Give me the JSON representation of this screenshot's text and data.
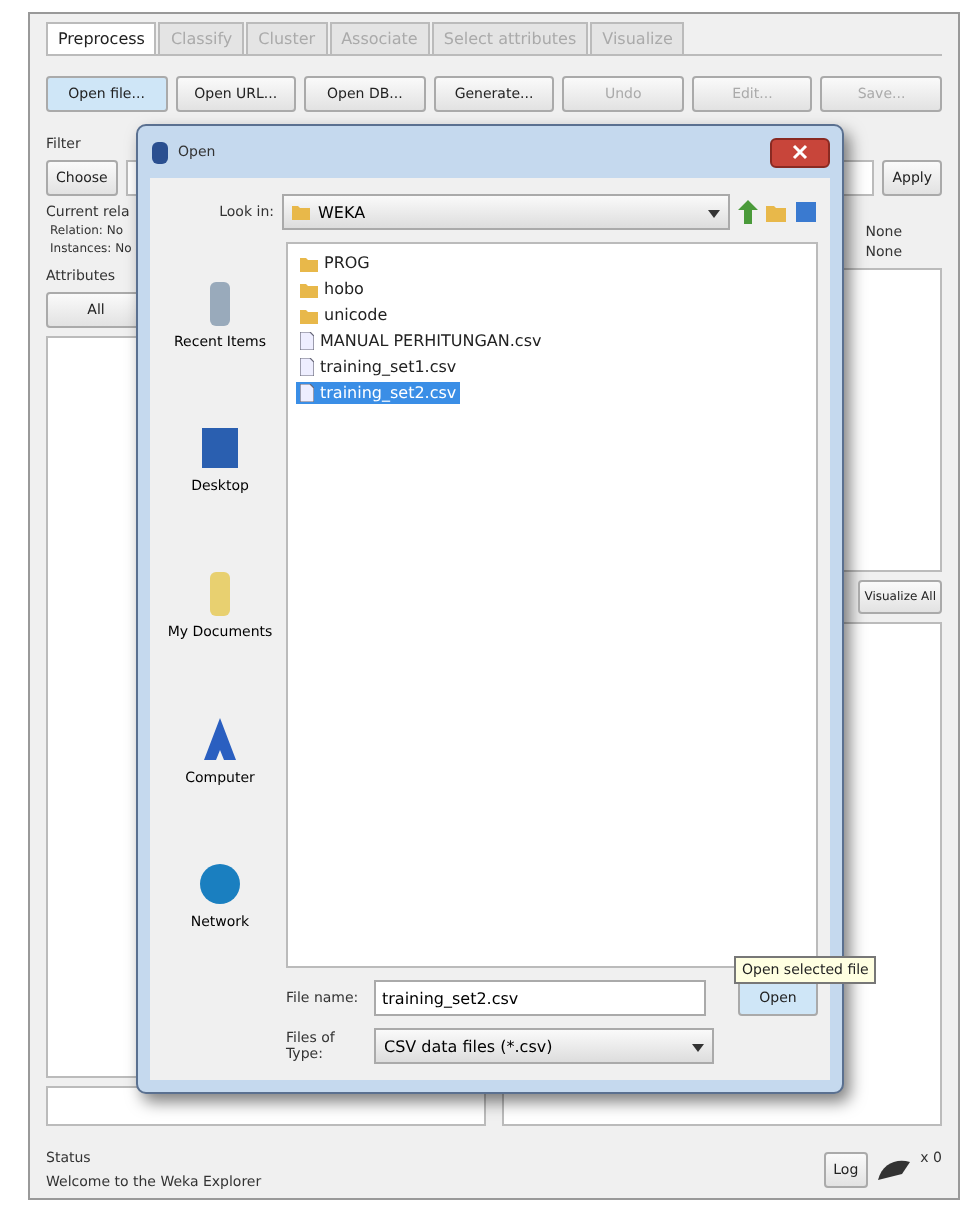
{
  "explorer": {
    "tabs": [
      {
        "label": "Preprocess",
        "selected": true
      },
      {
        "label": "Classify",
        "selected": false
      },
      {
        "label": "Cluster",
        "selected": false
      },
      {
        "label": "Associate",
        "selected": false
      },
      {
        "label": "Select attributes",
        "selected": false
      },
      {
        "label": "Visualize",
        "selected": false
      }
    ],
    "toolbar": [
      {
        "label": "Open file...",
        "disabled": false,
        "selected": true
      },
      {
        "label": "Open URL...",
        "disabled": false,
        "selected": false
      },
      {
        "label": "Open DB...",
        "disabled": false,
        "selected": false
      },
      {
        "label": "Generate...",
        "disabled": false,
        "selected": false
      },
      {
        "label": "Undo",
        "disabled": true,
        "selected": false
      },
      {
        "label": "Edit...",
        "disabled": true,
        "selected": false
      },
      {
        "label": "Save...",
        "disabled": true,
        "selected": false
      }
    ],
    "filter_label": "Filter",
    "choose_button": "Choose",
    "apply_button": "Apply",
    "current_relation": "Current rela",
    "relation": "Relation: No",
    "instances": "Instances: No",
    "right_values": [
      "None",
      "None"
    ],
    "attributes_label": "Attributes",
    "all_button": "All",
    "visualize_all_button": "Visualize All",
    "status_label": "Status",
    "status_message": "Welcome to the Weka Explorer",
    "log_button": "Log",
    "task_count": "x 0"
  },
  "dialog": {
    "title": "Open",
    "look_in_label": "Look in:",
    "look_in_value": "WEKA",
    "places": [
      {
        "label": "Recent Items"
      },
      {
        "label": "Desktop"
      },
      {
        "label": "My Documents"
      },
      {
        "label": "Computer"
      },
      {
        "label": "Network"
      }
    ],
    "files": [
      {
        "name": "PROG",
        "kind": "folder",
        "selected": false
      },
      {
        "name": "hobo",
        "kind": "folder",
        "selected": false
      },
      {
        "name": "unicode",
        "kind": "folder",
        "selected": false
      },
      {
        "name": "MANUAL PERHITUNGAN.csv",
        "kind": "file",
        "selected": false
      },
      {
        "name": "training_set1.csv",
        "kind": "file",
        "selected": false
      },
      {
        "name": "training_set2.csv",
        "kind": "file",
        "selected": true
      }
    ],
    "file_name_label": "File name:",
    "file_name_value": "training_set2.csv",
    "file_type_label": "Files of Type:",
    "file_type_value": "CSV data files (*.csv)",
    "open_button": "Open",
    "tooltip": "Open selected file"
  }
}
